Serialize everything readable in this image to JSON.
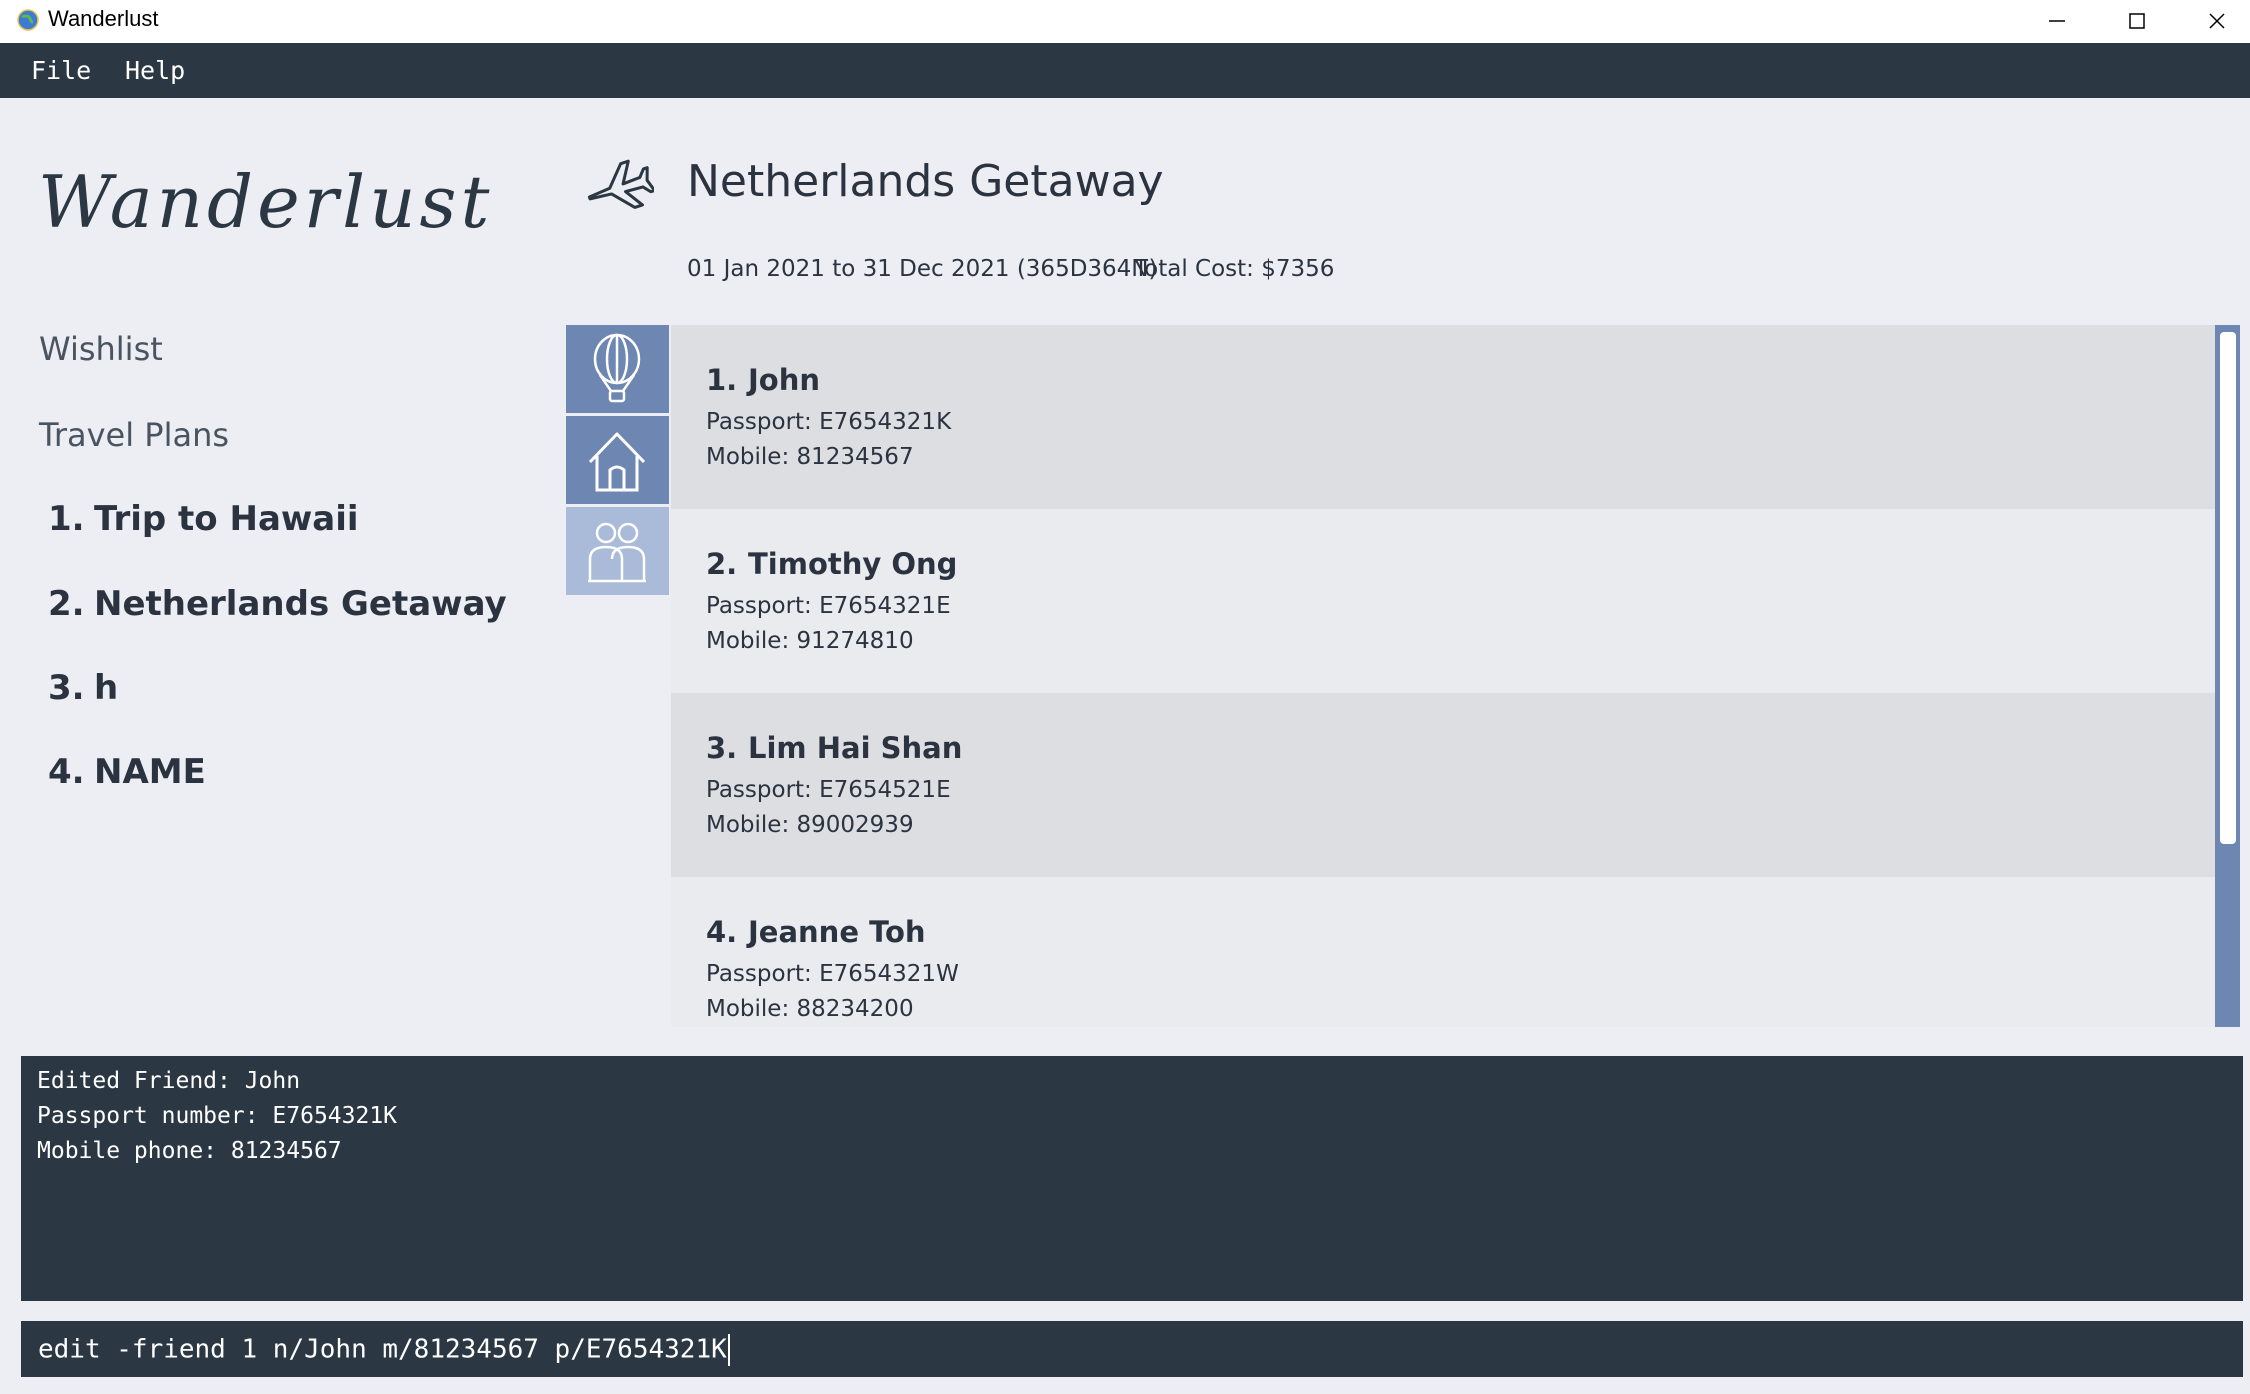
{
  "window": {
    "title": "Wanderlust"
  },
  "menu": {
    "file": "File",
    "help": "Help"
  },
  "brand": {
    "logo_text": "Wanderlust"
  },
  "nav": {
    "wishlist": "Wishlist",
    "travel_plans": "Travel Plans"
  },
  "travel_plans": [
    {
      "num": "1.",
      "name": "Trip to Hawaii"
    },
    {
      "num": "2.",
      "name": "Netherlands Getaway"
    },
    {
      "num": "3.",
      "name": "h"
    },
    {
      "num": "4.",
      "name": "NAME"
    }
  ],
  "trip": {
    "title": "Netherlands Getaway",
    "dates": "01 Jan 2021 to 31 Dec 2021 (365D364N)",
    "total_cost": "Total Cost: $7356"
  },
  "side_tabs": [
    {
      "icon": "hot-air-balloon-icon"
    },
    {
      "icon": "house-icon"
    },
    {
      "icon": "friends-icon"
    }
  ],
  "friends": [
    {
      "num": "1.",
      "name": "John",
      "passport": "Passport: E7654321K",
      "mobile": "Mobile: 81234567"
    },
    {
      "num": "2.",
      "name": "Timothy Ong",
      "passport": "Passport: E7654321E",
      "mobile": "Mobile: 91274810"
    },
    {
      "num": "3.",
      "name": "Lim Hai Shan",
      "passport": "Passport: E7654521E",
      "mobile": "Mobile: 89002939"
    },
    {
      "num": "4.",
      "name": "Jeanne Toh",
      "passport": "Passport: E7654321W",
      "mobile": "Mobile: 88234200"
    }
  ],
  "result": {
    "lines": [
      "Edited Friend: John",
      "Passport number: E7654321K",
      "Mobile phone: 81234567"
    ]
  },
  "command": {
    "value": "edit -friend 1 n/John m/81234567 p/E7654321K"
  },
  "colors": {
    "dark_panel": "#2b3743",
    "background": "#eceef3",
    "tab_active": "#6e87b2",
    "tab_inactive": "#a9bbd9",
    "card_dark": "#dcdee2",
    "card_light": "#e9ebef"
  }
}
